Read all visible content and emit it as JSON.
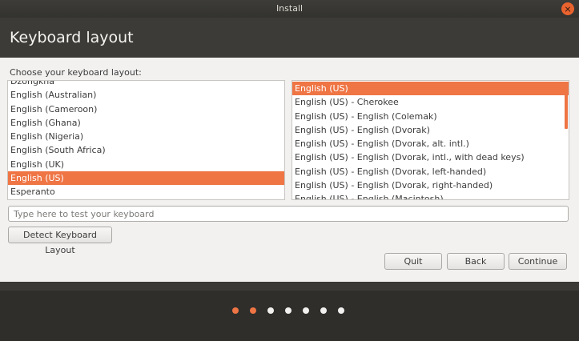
{
  "window": {
    "title": "Install"
  },
  "header": {
    "title": "Keyboard layout"
  },
  "layout_section": {
    "label": "Choose your keyboard layout:"
  },
  "languages": [
    {
      "label": "Dzongkha",
      "selected": false
    },
    {
      "label": "English (Australian)",
      "selected": false
    },
    {
      "label": "English (Cameroon)",
      "selected": false
    },
    {
      "label": "English (Ghana)",
      "selected": false
    },
    {
      "label": "English (Nigeria)",
      "selected": false
    },
    {
      "label": "English (South Africa)",
      "selected": false
    },
    {
      "label": "English (UK)",
      "selected": false
    },
    {
      "label": "English (US)",
      "selected": true
    },
    {
      "label": "Esperanto",
      "selected": false
    }
  ],
  "variants": [
    {
      "label": "English (US)",
      "selected": true
    },
    {
      "label": "English (US) - Cherokee",
      "selected": false
    },
    {
      "label": "English (US) - English (Colemak)",
      "selected": false
    },
    {
      "label": "English (US) - English (Dvorak)",
      "selected": false
    },
    {
      "label": "English (US) - English (Dvorak, alt. intl.)",
      "selected": false
    },
    {
      "label": "English (US) - English (Dvorak, intl., with dead keys)",
      "selected": false
    },
    {
      "label": "English (US) - English (Dvorak, left-handed)",
      "selected": false
    },
    {
      "label": "English (US) - English (Dvorak, right-handed)",
      "selected": false
    },
    {
      "label": "English (US) - English (Macintosh)",
      "selected": false
    }
  ],
  "test_field": {
    "placeholder": "Type here to test your keyboard",
    "value": ""
  },
  "buttons": {
    "detect": "Detect Keyboard Layout",
    "quit": "Quit",
    "back": "Back",
    "continue": "Continue"
  },
  "progress": {
    "total_steps": 7,
    "completed_steps": 2
  },
  "colors": {
    "accent": "#ef7545",
    "header_bg": "#3c3b37",
    "content_bg": "#f2f1f0"
  }
}
